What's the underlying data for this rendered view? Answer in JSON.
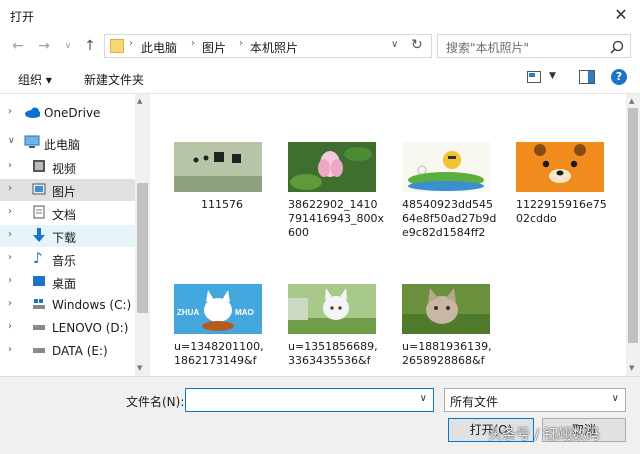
{
  "window": {
    "title": "打开"
  },
  "address": {
    "crumbs": [
      "此电脑",
      "图片",
      "本机照片"
    ]
  },
  "search": {
    "placeholder": "搜索\"本机照片\""
  },
  "toolbar": {
    "organize": "组织 ▾",
    "new_folder": "新建文件夹"
  },
  "nav": {
    "items": [
      {
        "label": "OneDrive"
      },
      {
        "label": "此电脑"
      },
      {
        "label": "视频"
      },
      {
        "label": "图片"
      },
      {
        "label": "文档"
      },
      {
        "label": "下载"
      },
      {
        "label": "音乐"
      },
      {
        "label": "桌面"
      },
      {
        "label": "Windows (C:)"
      },
      {
        "label": "LENOVO (D:)"
      },
      {
        "label": "DATA (E:)"
      }
    ]
  },
  "files": [
    {
      "name": "111576"
    },
    {
      "name": "38622902_1410791416943_800x600"
    },
    {
      "name": "48540923dd54564e8f50ad27b9de9c82d1584ff2"
    },
    {
      "name": "1122915916e7502cddo"
    },
    {
      "name": "u=1348201100,1862173149&f"
    },
    {
      "name": "u=1351856689,3363435536&f"
    },
    {
      "name": "u=1881936139,2658928868&f"
    }
  ],
  "bottom": {
    "filename_label": "文件名(N):",
    "filename_value": "",
    "filetype": "所有文件",
    "open": "打开(O)",
    "cancel": "取消"
  },
  "thumb_text": {
    "zhua": "ZHUA",
    "mao": "MAO"
  },
  "watermark": "头条号 / 钰翊数码",
  "colors": {
    "accent": "#0078d7",
    "selected": "#e0e0e0",
    "hover": "#e5f3fb"
  }
}
